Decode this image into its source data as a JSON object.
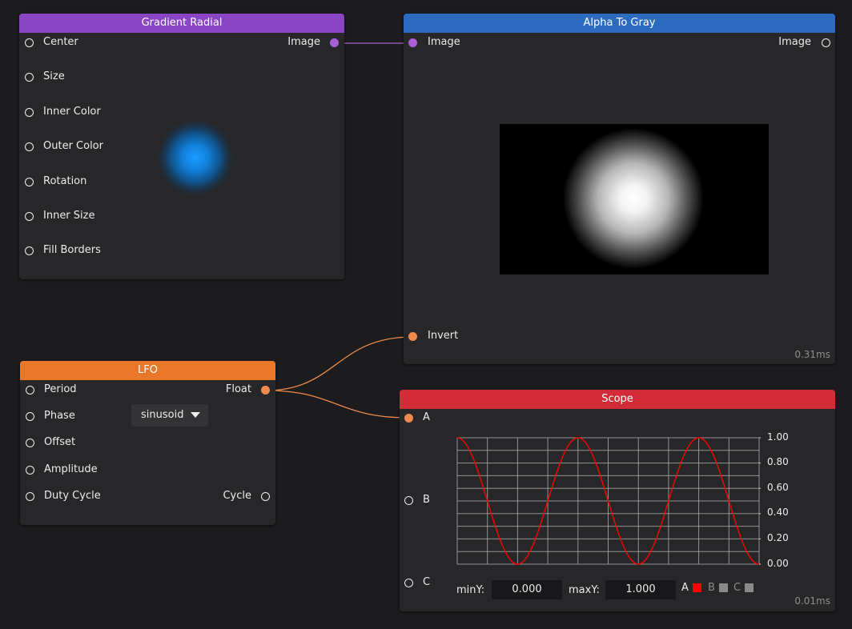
{
  "nodes": {
    "gradient_radial": {
      "title": "Gradient Radial",
      "header_color": "#8a45c5",
      "inputs": [
        "Center",
        "Size",
        "Inner Color",
        "Outer Color",
        "Rotation",
        "Inner Size",
        "Fill Borders"
      ],
      "output": "Image"
    },
    "alpha_to_gray": {
      "title": "Alpha To Gray",
      "header_color": "#2d6bc0",
      "input_image": "Image",
      "input_invert": "Invert",
      "output": "Image",
      "timing": "0.31ms"
    },
    "lfo": {
      "title": "LFO",
      "header_color": "#e8772a",
      "inputs": [
        "Period",
        "Phase",
        "Offset",
        "Amplitude",
        "Duty Cycle"
      ],
      "phase_mode": "sinusoid",
      "output_float": "Float",
      "output_cycle": "Cycle"
    },
    "scope": {
      "title": "Scope",
      "header_color": "#d42b38",
      "inputs": [
        "A",
        "B",
        "C"
      ],
      "y_ticks": [
        "1.00",
        "0.80",
        "0.60",
        "0.40",
        "0.20",
        "0.00"
      ],
      "min_label": "minY:",
      "min_value": "0.000",
      "max_label": "maxY:",
      "max_value": "1.000",
      "channels": [
        {
          "name": "A",
          "color": "#ff0000"
        },
        {
          "name": "B",
          "color": "#8a8a8a"
        },
        {
          "name": "C",
          "color": "#8a8a8a"
        }
      ],
      "timing": "0.01ms",
      "wave": {
        "cycles": 2.5,
        "start": 1.0,
        "min": 0.0,
        "max": 1.0
      }
    }
  }
}
